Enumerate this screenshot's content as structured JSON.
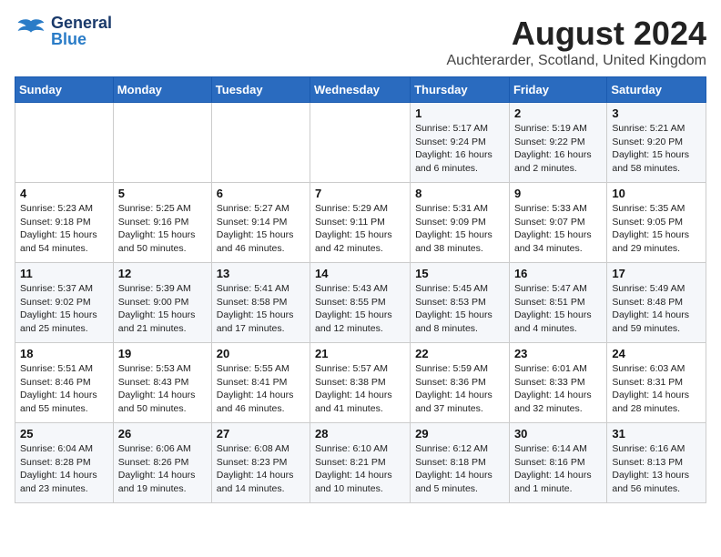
{
  "header": {
    "logo_general": "General",
    "logo_blue": "Blue",
    "title": "August 2024",
    "subtitle": "Auchterarder, Scotland, United Kingdom"
  },
  "weekdays": [
    "Sunday",
    "Monday",
    "Tuesday",
    "Wednesday",
    "Thursday",
    "Friday",
    "Saturday"
  ],
  "weeks": [
    [
      {
        "day": "",
        "info": ""
      },
      {
        "day": "",
        "info": ""
      },
      {
        "day": "",
        "info": ""
      },
      {
        "day": "",
        "info": ""
      },
      {
        "day": "1",
        "info": "Sunrise: 5:17 AM\nSunset: 9:24 PM\nDaylight: 16 hours\nand 6 minutes."
      },
      {
        "day": "2",
        "info": "Sunrise: 5:19 AM\nSunset: 9:22 PM\nDaylight: 16 hours\nand 2 minutes."
      },
      {
        "day": "3",
        "info": "Sunrise: 5:21 AM\nSunset: 9:20 PM\nDaylight: 15 hours\nand 58 minutes."
      }
    ],
    [
      {
        "day": "4",
        "info": "Sunrise: 5:23 AM\nSunset: 9:18 PM\nDaylight: 15 hours\nand 54 minutes."
      },
      {
        "day": "5",
        "info": "Sunrise: 5:25 AM\nSunset: 9:16 PM\nDaylight: 15 hours\nand 50 minutes."
      },
      {
        "day": "6",
        "info": "Sunrise: 5:27 AM\nSunset: 9:14 PM\nDaylight: 15 hours\nand 46 minutes."
      },
      {
        "day": "7",
        "info": "Sunrise: 5:29 AM\nSunset: 9:11 PM\nDaylight: 15 hours\nand 42 minutes."
      },
      {
        "day": "8",
        "info": "Sunrise: 5:31 AM\nSunset: 9:09 PM\nDaylight: 15 hours\nand 38 minutes."
      },
      {
        "day": "9",
        "info": "Sunrise: 5:33 AM\nSunset: 9:07 PM\nDaylight: 15 hours\nand 34 minutes."
      },
      {
        "day": "10",
        "info": "Sunrise: 5:35 AM\nSunset: 9:05 PM\nDaylight: 15 hours\nand 29 minutes."
      }
    ],
    [
      {
        "day": "11",
        "info": "Sunrise: 5:37 AM\nSunset: 9:02 PM\nDaylight: 15 hours\nand 25 minutes."
      },
      {
        "day": "12",
        "info": "Sunrise: 5:39 AM\nSunset: 9:00 PM\nDaylight: 15 hours\nand 21 minutes."
      },
      {
        "day": "13",
        "info": "Sunrise: 5:41 AM\nSunset: 8:58 PM\nDaylight: 15 hours\nand 17 minutes."
      },
      {
        "day": "14",
        "info": "Sunrise: 5:43 AM\nSunset: 8:55 PM\nDaylight: 15 hours\nand 12 minutes."
      },
      {
        "day": "15",
        "info": "Sunrise: 5:45 AM\nSunset: 8:53 PM\nDaylight: 15 hours\nand 8 minutes."
      },
      {
        "day": "16",
        "info": "Sunrise: 5:47 AM\nSunset: 8:51 PM\nDaylight: 15 hours\nand 4 minutes."
      },
      {
        "day": "17",
        "info": "Sunrise: 5:49 AM\nSunset: 8:48 PM\nDaylight: 14 hours\nand 59 minutes."
      }
    ],
    [
      {
        "day": "18",
        "info": "Sunrise: 5:51 AM\nSunset: 8:46 PM\nDaylight: 14 hours\nand 55 minutes."
      },
      {
        "day": "19",
        "info": "Sunrise: 5:53 AM\nSunset: 8:43 PM\nDaylight: 14 hours\nand 50 minutes."
      },
      {
        "day": "20",
        "info": "Sunrise: 5:55 AM\nSunset: 8:41 PM\nDaylight: 14 hours\nand 46 minutes."
      },
      {
        "day": "21",
        "info": "Sunrise: 5:57 AM\nSunset: 8:38 PM\nDaylight: 14 hours\nand 41 minutes."
      },
      {
        "day": "22",
        "info": "Sunrise: 5:59 AM\nSunset: 8:36 PM\nDaylight: 14 hours\nand 37 minutes."
      },
      {
        "day": "23",
        "info": "Sunrise: 6:01 AM\nSunset: 8:33 PM\nDaylight: 14 hours\nand 32 minutes."
      },
      {
        "day": "24",
        "info": "Sunrise: 6:03 AM\nSunset: 8:31 PM\nDaylight: 14 hours\nand 28 minutes."
      }
    ],
    [
      {
        "day": "25",
        "info": "Sunrise: 6:04 AM\nSunset: 8:28 PM\nDaylight: 14 hours\nand 23 minutes."
      },
      {
        "day": "26",
        "info": "Sunrise: 6:06 AM\nSunset: 8:26 PM\nDaylight: 14 hours\nand 19 minutes."
      },
      {
        "day": "27",
        "info": "Sunrise: 6:08 AM\nSunset: 8:23 PM\nDaylight: 14 hours\nand 14 minutes."
      },
      {
        "day": "28",
        "info": "Sunrise: 6:10 AM\nSunset: 8:21 PM\nDaylight: 14 hours\nand 10 minutes."
      },
      {
        "day": "29",
        "info": "Sunrise: 6:12 AM\nSunset: 8:18 PM\nDaylight: 14 hours\nand 5 minutes."
      },
      {
        "day": "30",
        "info": "Sunrise: 6:14 AM\nSunset: 8:16 PM\nDaylight: 14 hours\nand 1 minute."
      },
      {
        "day": "31",
        "info": "Sunrise: 6:16 AM\nSunset: 8:13 PM\nDaylight: 13 hours\nand 56 minutes."
      }
    ]
  ]
}
